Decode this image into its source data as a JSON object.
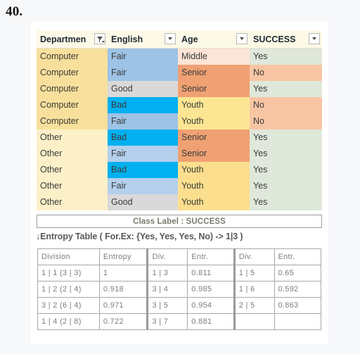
{
  "question_number": "40.",
  "data_table": {
    "headers": [
      {
        "label": "Departmen",
        "filter_icon": "filter-applied-icon",
        "filter_applied": true
      },
      {
        "label": "English",
        "filter_icon": "chevron-down-icon",
        "filter_applied": false
      },
      {
        "label": "Age",
        "filter_icon": "chevron-down-icon",
        "filter_applied": false
      },
      {
        "label": "SUCCESS",
        "filter_icon": "chevron-down-icon",
        "filter_applied": false
      }
    ],
    "rows": [
      {
        "department": "Computer",
        "english": "Fair",
        "age": "Middle",
        "success": "Yes"
      },
      {
        "department": "Computer",
        "english": "Fair",
        "age": "Senior",
        "success": "No"
      },
      {
        "department": "Computer",
        "english": "Good",
        "age": "Senior",
        "success": "Yes"
      },
      {
        "department": "Computer",
        "english": "Bad",
        "age": "Youth",
        "success": "No"
      },
      {
        "department": "Computer",
        "english": "Fair",
        "age": "Youth",
        "success": "No"
      },
      {
        "department": "Other",
        "english": "Bad",
        "age": "Senior",
        "success": "Yes"
      },
      {
        "department": "Other",
        "english": "Fair",
        "age": "Senior",
        "success": "Yes"
      },
      {
        "department": "Other",
        "english": "Bad",
        "age": "Youth",
        "success": "Yes"
      },
      {
        "department": "Other",
        "english": "Fair",
        "age": "Youth",
        "success": "Yes"
      },
      {
        "department": "Other",
        "english": "Good",
        "age": "Youth",
        "success": "Yes"
      }
    ],
    "cell_colors": {
      "department_computer": "#f8e09c",
      "department_other": "#fcf0c9",
      "english_bad": "#00b0f0",
      "english_fair_computer": "#9dc3e6",
      "english_fair_other": "#b4d0ec",
      "english_good": "#d9d9d9",
      "age_middle": "#fce4d6",
      "age_senior": "#f0a173",
      "age_youth_computer": "#fce694",
      "age_youth_other": "#fcdf8e",
      "success_yes": "#dfe8da",
      "success_no": "#f8c5a4"
    }
  },
  "class_label_bar": "Class Label : SUCCESS",
  "entropy_caption": {
    "arrow": "↓",
    "text": "Entropy Table ( For.Ex: {Yes, Yes, Yes, No) -> 1|3 )"
  },
  "entropy_table": {
    "headers": [
      "Division",
      "Entropy",
      "Div.",
      "Entr.",
      "Div.",
      "Entr."
    ],
    "rows": [
      [
        "1 | 1 (3 | 3)",
        "1",
        "1 | 3",
        "0.811",
        "1 | 5",
        "0.65"
      ],
      [
        "1 | 2 (2 | 4)",
        "0.918",
        "3 | 4",
        "0.985",
        "1 | 6",
        "0.592"
      ],
      [
        "3 | 2 (6 | 4)",
        "0.971",
        "3 | 5",
        "0.954",
        "2 | 5",
        "0.863"
      ],
      [
        "1 | 4 (2 | 8)",
        "0.722",
        "3 | 7",
        "0.881",
        "",
        ""
      ]
    ]
  }
}
